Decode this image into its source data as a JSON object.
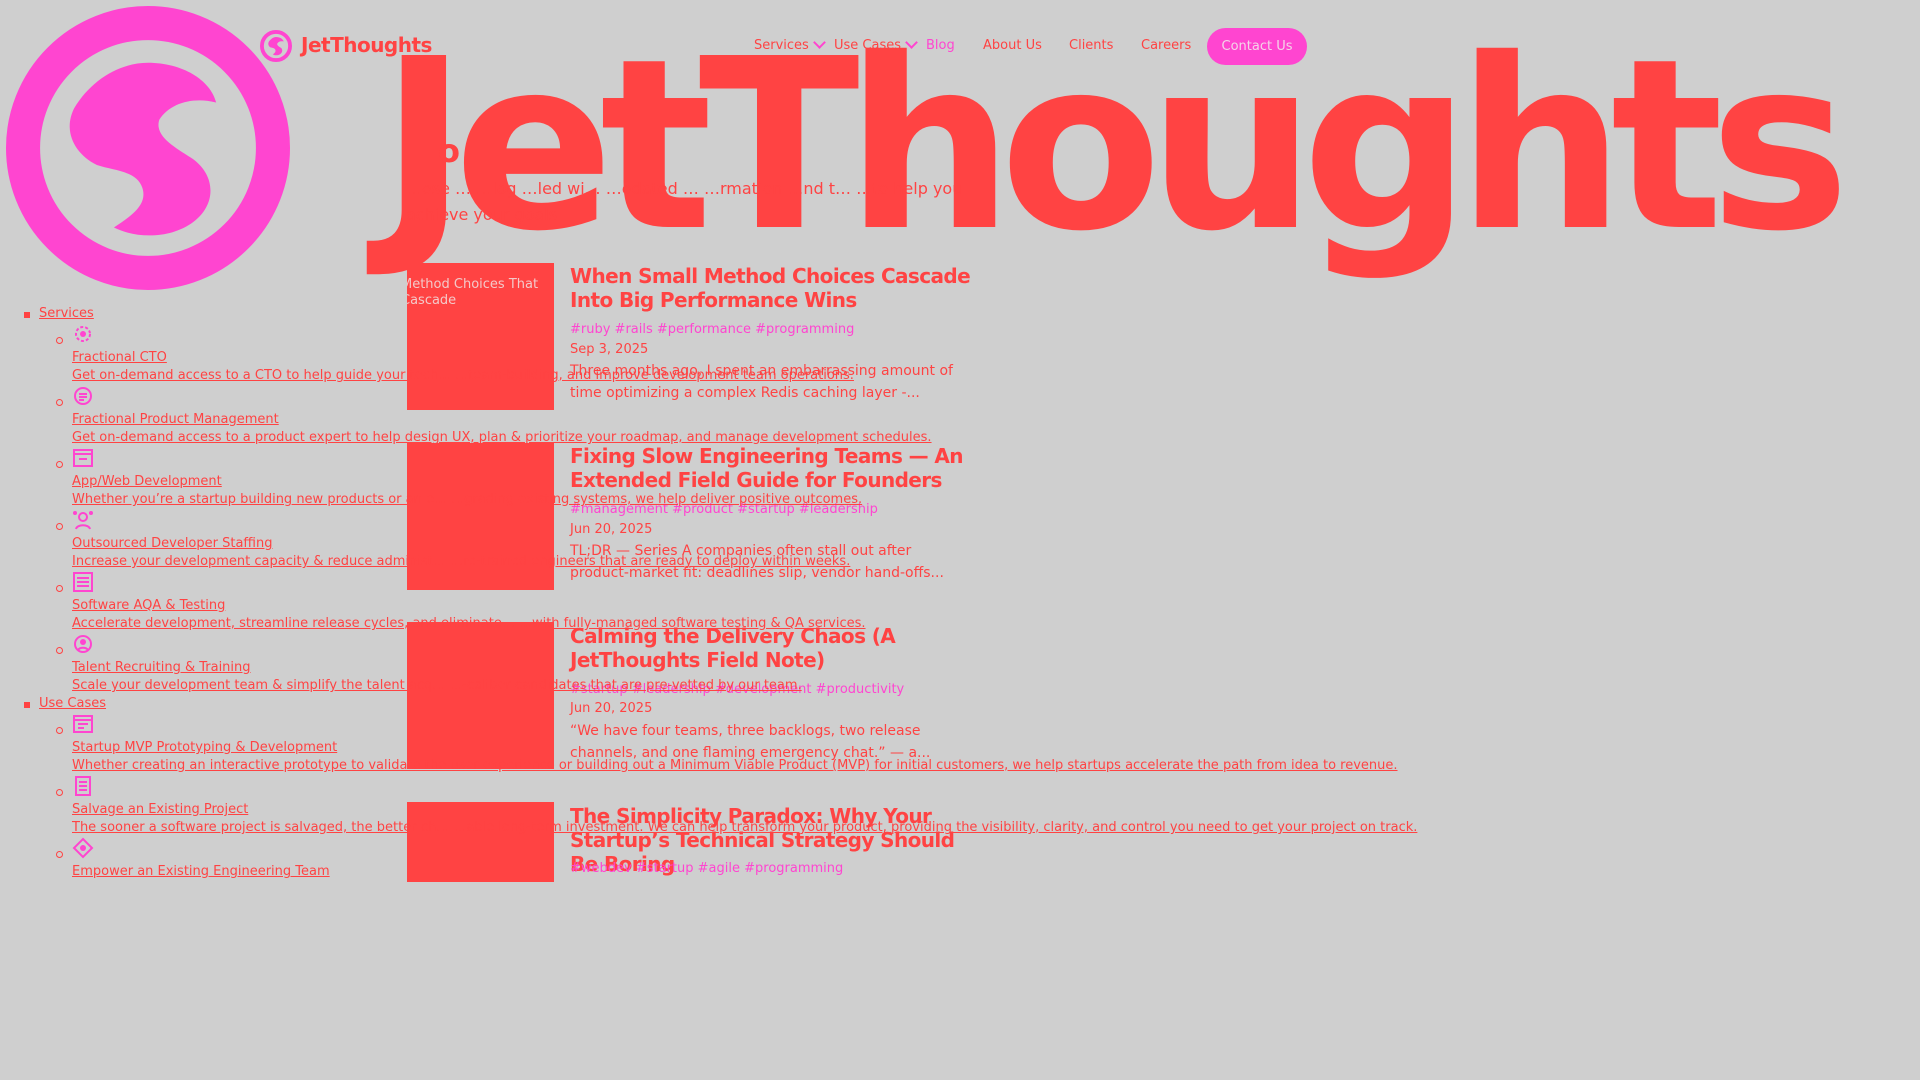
{
  "brand": {
    "name": "JetThoughts",
    "bg_word": "JetThoughts",
    "primary_color": "#ff4343",
    "accent_color": "#ff45d0",
    "background": "#cfcfcf"
  },
  "nav": {
    "items": [
      {
        "label": "Services",
        "has_dropdown": true
      },
      {
        "label": "Use Cases",
        "has_dropdown": true
      },
      {
        "label": "Blog",
        "active": true
      },
      {
        "label": "About Us"
      },
      {
        "label": "Clients"
      },
      {
        "label": "Careers"
      }
    ],
    "contact_label": "Contact Us"
  },
  "intro": {
    "heading_fragment": "o",
    "text": "…ose … …log …led wi… …odated … …rmation …nd t… …to help you achieve your goals."
  },
  "posts": [
    {
      "thumb_caption_1": "Method Choices That",
      "thumb_caption_2": "Cascade",
      "title": "When Small Method Choices Cascade Into Big Performance Wins",
      "tags": "#ruby #rails #performance #programming",
      "date": "Sep 3, 2025",
      "excerpt": "Three months ago, I spent an embarrassing amount of time optimizing a complex Redis caching layer -..."
    },
    {
      "title": "Fixing Slow Engineering Teams — An Extended Field Guide for Founders",
      "tags": "#management #product #startup #leadership",
      "date": "Jun 20, 2025",
      "excerpt": "TL;DR — Series A companies often stall out after product‑market fit: deadlines slip, vendor hand‑offs..."
    },
    {
      "title": "Calming the Delivery Chaos (A JetThoughts Field Note)",
      "tags": "#startup #leadership #development #productivity",
      "date": "Jun 20, 2025",
      "excerpt": "“We have four teams, three backlogs, two release channels, and one flaming emergency chat.” — a..."
    },
    {
      "title": "The Simplicity Paradox: Why Your Startup’s Technical Strategy Should Be Boring",
      "tags": "#webdev #startup #agile #programming"
    }
  ],
  "side_menu": {
    "services_label": "Services",
    "use_cases_label": "Use Cases",
    "services": [
      {
        "icon": "cto-gear-icon",
        "title": "Fractional CTO",
        "desc": "Get on-demand access to a CTO to help guide your tech… …team-building, and improve development team operations."
      },
      {
        "icon": "product-management-icon",
        "title": "Fractional Product Management",
        "desc": "Get on-demand access to a product expert to help design UX, plan & prioritize your roadmap, and manage development schedules."
      },
      {
        "icon": "web-window-icon",
        "title": "App/Web Development",
        "desc": "Whether you’re a startup building new products or an e… …grading existing systems, we help deliver positive outcomes."
      },
      {
        "icon": "developer-staffing-icon",
        "title": "Outsourced Developer Staffing",
        "desc": "Increase your development capacity & reduce administ… …re-trained engineers that are ready to deploy within weeks."
      },
      {
        "icon": "testing-list-icon",
        "title": "Software AQA & Testing",
        "desc": "Accelerate development, streamline release cycles, and eliminate… …with fully-managed software testing & QA services."
      },
      {
        "icon": "recruiting-icon",
        "title": "Talent Recruiting & Training",
        "desc": "Scale your development team & simplify the talent acq… …-caliber candidates that are pre-vetted by our team."
      }
    ],
    "use_cases": [
      {
        "icon": "prototype-window-icon",
        "title": "Startup MVP Prototyping & Development",
        "desc": "Whether creating an interactive prototype to validate the user experience or building out a Minimum Viable Product (MVP) for initial customers, we help startups accelerate the path from idea to revenue."
      },
      {
        "icon": "salvage-document-icon",
        "title": "Salvage an Existing Project",
        "desc": "The sooner a software project is salvaged, the better ch… …able long-term investment. We can help transform your product, providing the visibility, clarity, and control you need to get your project on track."
      },
      {
        "icon": "empower-diamond-icon",
        "title": "Empower an Existing Engineering Team"
      }
    ]
  }
}
